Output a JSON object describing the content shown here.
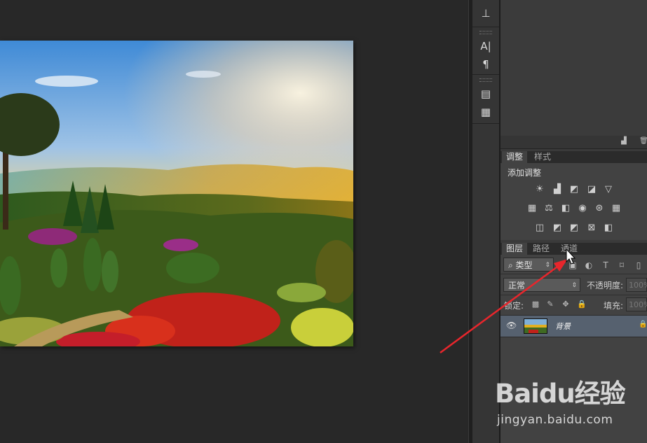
{
  "adjustments_panel": {
    "tabs": [
      "调整",
      "样式"
    ],
    "title": "添加调整"
  },
  "layers_panel": {
    "tabs": [
      "图层",
      "路径",
      "通道"
    ],
    "filter_kind": "类型",
    "blend_mode": "正常",
    "opacity_label": "不透明度:",
    "opacity_value": "100%",
    "lock_label": "锁定:",
    "fill_label": "填充:",
    "fill_value": "100%",
    "layers": [
      {
        "name": "背景",
        "visible": true,
        "locked": true
      }
    ]
  },
  "watermark": {
    "brand": "Baidu经验",
    "url": "jingyan.baidu.com"
  },
  "colors": {
    "selected_layer_row": "#56616f",
    "annotation_arrow": "#e8262c"
  }
}
